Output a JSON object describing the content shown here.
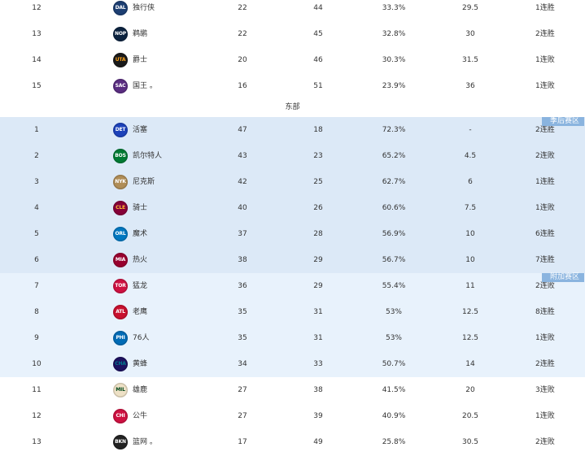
{
  "west_tail": [
    {
      "rank": "12",
      "abbr": "DAL",
      "team": "独行侠",
      "w": "22",
      "l": "44",
      "pct": "33.3%",
      "gb": "29.5",
      "streak": "1连胜",
      "logo_bg": "#1d3f73",
      "logo_fg": "#ffffff"
    },
    {
      "rank": "13",
      "abbr": "NOP",
      "team": "鹈鹕",
      "w": "22",
      "l": "45",
      "pct": "32.8%",
      "gb": "30",
      "streak": "2连胜",
      "logo_bg": "#0c2340",
      "logo_fg": "#ffffff"
    },
    {
      "rank": "14",
      "abbr": "UTA",
      "team": "爵士",
      "w": "20",
      "l": "46",
      "pct": "30.3%",
      "gb": "31.5",
      "streak": "1连败",
      "logo_bg": "#1a1a1a",
      "logo_fg": "#f9a01b"
    },
    {
      "rank": "15",
      "abbr": "SAC",
      "team": "国王 。",
      "w": "16",
      "l": "51",
      "pct": "23.9%",
      "gb": "36",
      "streak": "1连败",
      "logo_bg": "#5a2d81",
      "logo_fg": "#ffffff"
    }
  ],
  "east_label": "东部",
  "playoff_label": "季后赛区",
  "playin_label": "附加赛区",
  "east": [
    {
      "rank": "1",
      "abbr": "DET",
      "team": "活塞",
      "w": "47",
      "l": "18",
      "pct": "72.3%",
      "gb": "-",
      "streak": "2连胜",
      "logo_bg": "#1d42ba",
      "logo_fg": "#ffffff"
    },
    {
      "rank": "2",
      "abbr": "BOS",
      "team": "凯尔特人",
      "w": "43",
      "l": "23",
      "pct": "65.2%",
      "gb": "4.5",
      "streak": "2连败",
      "logo_bg": "#007a33",
      "logo_fg": "#ffffff"
    },
    {
      "rank": "3",
      "abbr": "NYK",
      "team": "尼克斯",
      "w": "42",
      "l": "25",
      "pct": "62.7%",
      "gb": "6",
      "streak": "1连胜",
      "logo_bg": "#b08d57",
      "logo_fg": "#ffffff"
    },
    {
      "rank": "4",
      "abbr": "CLE",
      "team": "骑士",
      "w": "40",
      "l": "26",
      "pct": "60.6%",
      "gb": "7.5",
      "streak": "1连败",
      "logo_bg": "#860038",
      "logo_fg": "#fdbb30"
    },
    {
      "rank": "5",
      "abbr": "ORL",
      "team": "魔术",
      "w": "37",
      "l": "28",
      "pct": "56.9%",
      "gb": "10",
      "streak": "6连胜",
      "logo_bg": "#0077c0",
      "logo_fg": "#ffffff"
    },
    {
      "rank": "6",
      "abbr": "MIA",
      "team": "热火",
      "w": "38",
      "l": "29",
      "pct": "56.7%",
      "gb": "10",
      "streak": "7连胜",
      "logo_bg": "#98002e",
      "logo_fg": "#ffffff"
    },
    {
      "rank": "7",
      "abbr": "TOR",
      "team": "猛龙",
      "w": "36",
      "l": "29",
      "pct": "55.4%",
      "gb": "11",
      "streak": "2连败",
      "logo_bg": "#ce1141",
      "logo_fg": "#ffffff"
    },
    {
      "rank": "8",
      "abbr": "ATL",
      "team": "老鹰",
      "w": "35",
      "l": "31",
      "pct": "53%",
      "gb": "12.5",
      "streak": "8连胜",
      "logo_bg": "#c8102e",
      "logo_fg": "#ffffff"
    },
    {
      "rank": "9",
      "abbr": "PHI",
      "team": "76人",
      "w": "35",
      "l": "31",
      "pct": "53%",
      "gb": "12.5",
      "streak": "1连败",
      "logo_bg": "#006bb6",
      "logo_fg": "#ffffff"
    },
    {
      "rank": "10",
      "abbr": "CHA",
      "team": "黄蜂",
      "w": "34",
      "l": "33",
      "pct": "50.7%",
      "gb": "14",
      "streak": "2连胜",
      "logo_bg": "#1d1160",
      "logo_fg": "#00788c"
    },
    {
      "rank": "11",
      "abbr": "MIL",
      "team": "雄鹿",
      "w": "27",
      "l": "38",
      "pct": "41.5%",
      "gb": "20",
      "streak": "3连败",
      "logo_bg": "#eee1c6",
      "logo_fg": "#00471b"
    },
    {
      "rank": "12",
      "abbr": "CHI",
      "team": "公牛",
      "w": "27",
      "l": "39",
      "pct": "40.9%",
      "gb": "20.5",
      "streak": "1连败",
      "logo_bg": "#ce1141",
      "logo_fg": "#ffffff"
    },
    {
      "rank": "13",
      "abbr": "BKN",
      "team": "篮网 。",
      "w": "17",
      "l": "49",
      "pct": "25.8%",
      "gb": "30.5",
      "streak": "2连败",
      "logo_bg": "#222222",
      "logo_fg": "#ffffff"
    }
  ]
}
